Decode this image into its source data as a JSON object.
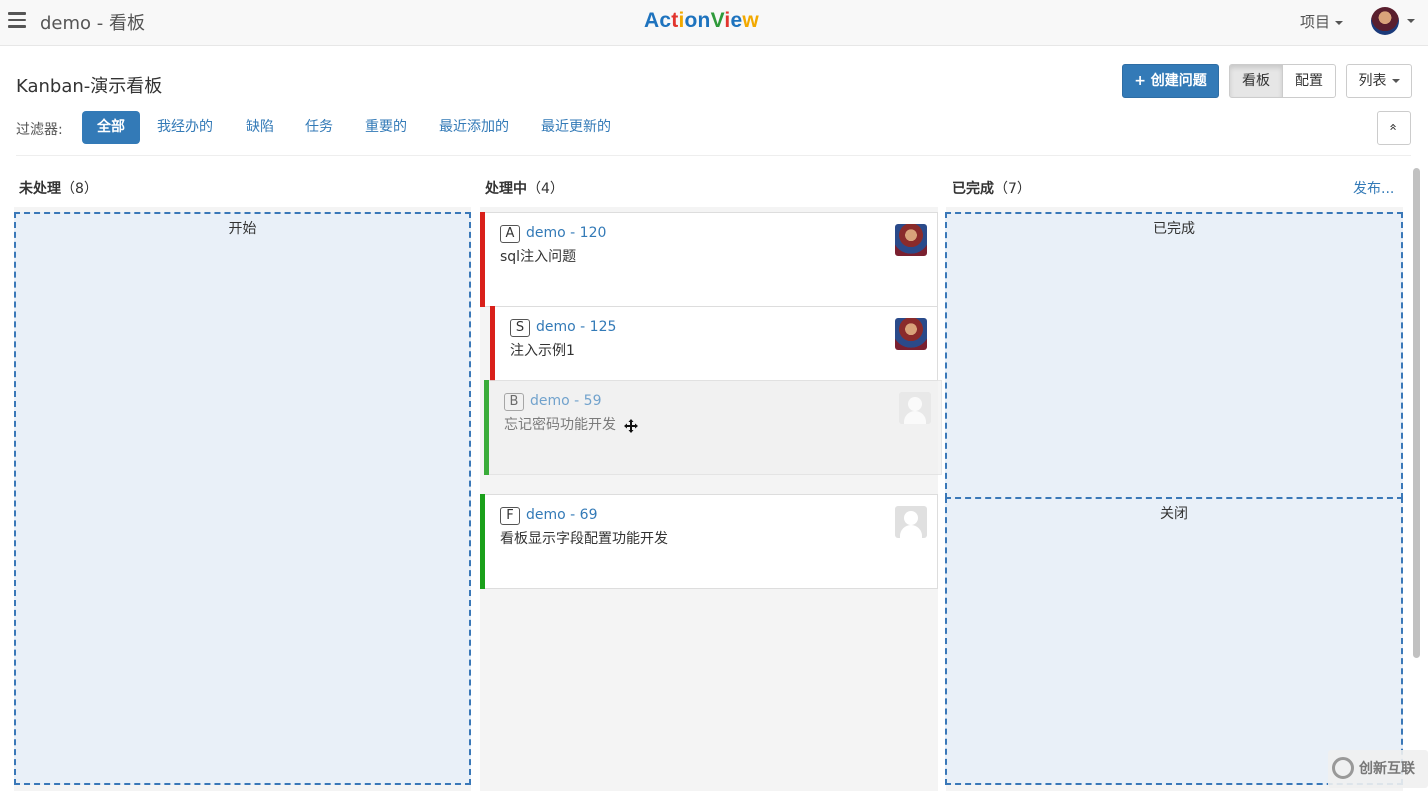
{
  "navbar": {
    "title": "demo - 看板",
    "brand_letters": [
      {
        "ch": "A",
        "color": "#1e73be"
      },
      {
        "ch": "c",
        "color": "#1e73be"
      },
      {
        "ch": "t",
        "color": "#e2342d"
      },
      {
        "ch": "i",
        "color": "#f2a900"
      },
      {
        "ch": "o",
        "color": "#1e73be"
      },
      {
        "ch": "n",
        "color": "#1e73be"
      },
      {
        "ch": "V",
        "color": "#2f9a3b"
      },
      {
        "ch": "i",
        "color": "#e2342d"
      },
      {
        "ch": "e",
        "color": "#1e73be"
      },
      {
        "ch": "w",
        "color": "#f2a900"
      }
    ],
    "project_label": "项目"
  },
  "page": {
    "title": "Kanban-演示看板",
    "create_button": "创建问题",
    "create_icon": "+",
    "view_board": "看板",
    "view_config": "配置",
    "list_button": "列表",
    "filter_label": "过滤器:",
    "filters": [
      "全部",
      "我经办的",
      "缺陷",
      "任务",
      "重要的",
      "最近添加的",
      "最近更新的"
    ],
    "active_filter": "全部",
    "collapse_icon": "»"
  },
  "columns": [
    {
      "name": "未处理",
      "count": "（8）",
      "zones": [
        "开始"
      ]
    },
    {
      "name": "处理中",
      "count": "（4）"
    },
    {
      "name": "已完成",
      "count": "（7）",
      "zones": [
        "已完成",
        "关闭"
      ],
      "action": "发布..."
    }
  ],
  "cards": [
    {
      "type": "A",
      "key": "demo - 120",
      "summary": "sql注入问题",
      "bar_color": "#d9201a",
      "avatar": "photo"
    },
    {
      "type": "S",
      "key": "demo - 125",
      "summary": "注入示例1",
      "bar_color": "#d9201a",
      "avatar": "photo"
    },
    {
      "type": "B",
      "key": "demo - 59",
      "summary": "忘记密码功能开发",
      "bar_color": "#1aa01a",
      "avatar": "placeholder",
      "dragging": true
    },
    {
      "type": "F",
      "key": "demo - 69",
      "summary": "看板显示字段配置功能开发",
      "bar_color": "#1aa01a",
      "avatar": "placeholder"
    }
  ],
  "watermark": "创新互联",
  "colors": {
    "primary": "#337ab7",
    "dropzone_border": "#3a78b8",
    "dropzone_bg": "#e9f0f8"
  }
}
